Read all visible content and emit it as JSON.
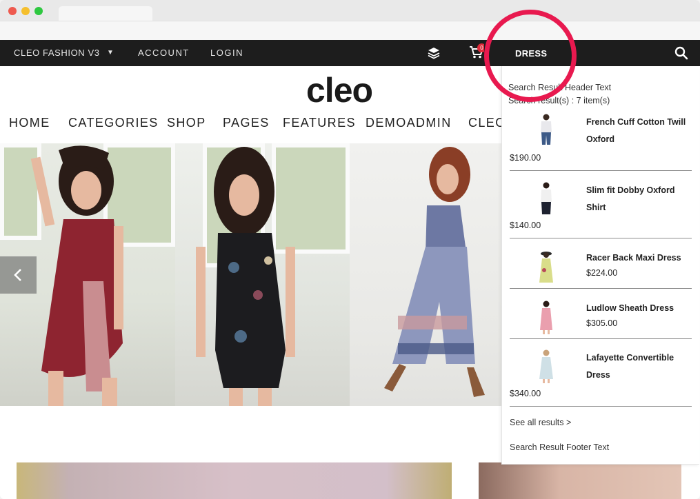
{
  "topbar": {
    "store_switch": "CLEO FASHION V3",
    "account": "ACCOUNT",
    "login": "LOGIN",
    "cart_count": "0",
    "icons": [
      "layers-icon",
      "cart-icon",
      "search-icon",
      "caret-down-icon"
    ]
  },
  "logo": "cleo",
  "nav": {
    "items": [
      "HOME",
      "CATEGORIES",
      "SHOP",
      "PAGES",
      "FEATURES",
      "DEMOADMIN",
      "CLEO"
    ]
  },
  "search": {
    "value": "DRESS",
    "header_text": "Search Result Header Text",
    "count_text": "Search result(s) : 7 item(s)",
    "results": [
      {
        "name": "French Cuff Cotton Twill Oxford",
        "price": "$190.00"
      },
      {
        "name": "Slim fit Dobby Oxford Shirt",
        "price": "$140.00"
      },
      {
        "name": "Racer Back Maxi Dress",
        "price": "$224.00"
      },
      {
        "name": "Ludlow Sheath Dress",
        "price": "$305.00"
      },
      {
        "name": "Lafayette Convertible Dress",
        "price": "$340.00"
      }
    ],
    "see_all": "See all results >",
    "footer_text": "Search Result Footer Text"
  },
  "colors": {
    "topbar_bg": "#1d1d1d",
    "highlight_ring": "#e8194f",
    "badge": "#e02b3a"
  }
}
